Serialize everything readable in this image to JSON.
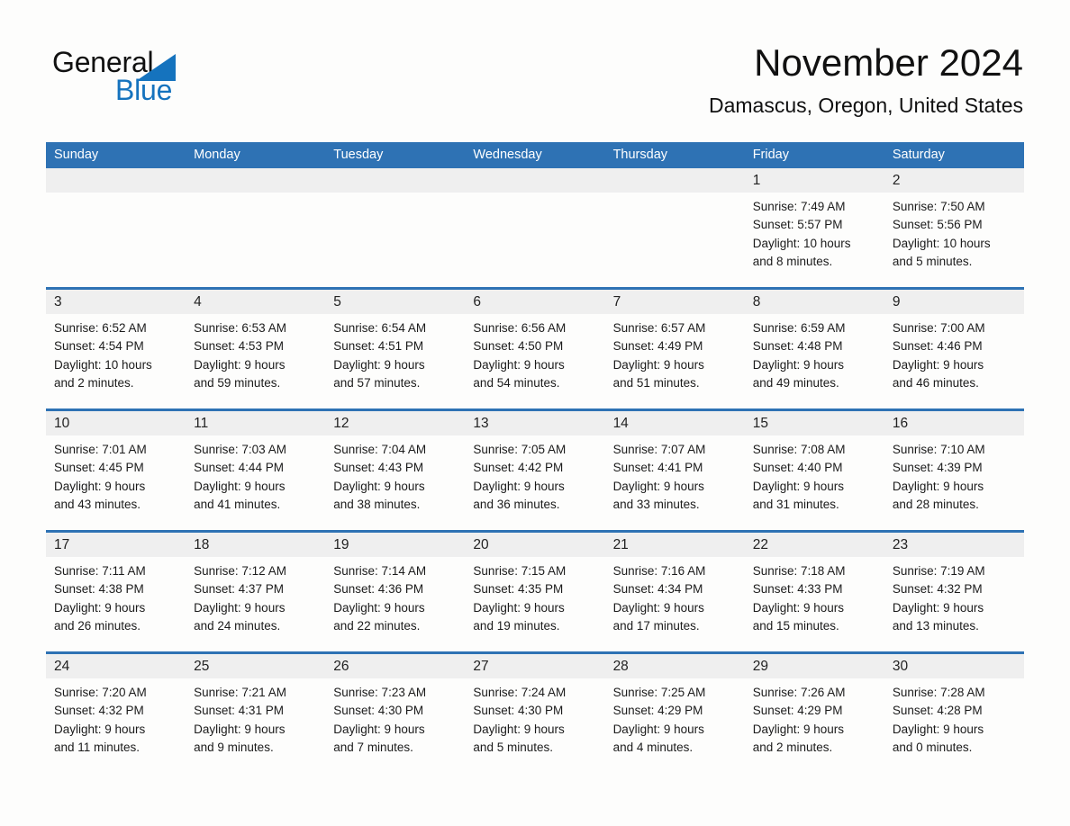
{
  "brand": {
    "name_part1": "General",
    "name_part2": "Blue",
    "triangle_color": "#1573BE"
  },
  "header": {
    "month_year": "November 2024",
    "location": "Damascus, Oregon, United States"
  },
  "theme": {
    "header_blue": "#2E72B4",
    "day_band_gray": "#EFEFEF",
    "page_background": "#FDFDFC",
    "text_color": "#1B1B1B"
  },
  "weekdays": [
    "Sunday",
    "Monday",
    "Tuesday",
    "Wednesday",
    "Thursday",
    "Friday",
    "Saturday"
  ],
  "weeks": [
    [
      {
        "day": "",
        "sunrise": "",
        "sunset": "",
        "daylight_line1": "",
        "daylight_line2": ""
      },
      {
        "day": "",
        "sunrise": "",
        "sunset": "",
        "daylight_line1": "",
        "daylight_line2": ""
      },
      {
        "day": "",
        "sunrise": "",
        "sunset": "",
        "daylight_line1": "",
        "daylight_line2": ""
      },
      {
        "day": "",
        "sunrise": "",
        "sunset": "",
        "daylight_line1": "",
        "daylight_line2": ""
      },
      {
        "day": "",
        "sunrise": "",
        "sunset": "",
        "daylight_line1": "",
        "daylight_line2": ""
      },
      {
        "day": "1",
        "sunrise": "Sunrise: 7:49 AM",
        "sunset": "Sunset: 5:57 PM",
        "daylight_line1": "Daylight: 10 hours",
        "daylight_line2": "and 8 minutes."
      },
      {
        "day": "2",
        "sunrise": "Sunrise: 7:50 AM",
        "sunset": "Sunset: 5:56 PM",
        "daylight_line1": "Daylight: 10 hours",
        "daylight_line2": "and 5 minutes."
      }
    ],
    [
      {
        "day": "3",
        "sunrise": "Sunrise: 6:52 AM",
        "sunset": "Sunset: 4:54 PM",
        "daylight_line1": "Daylight: 10 hours",
        "daylight_line2": "and 2 minutes."
      },
      {
        "day": "4",
        "sunrise": "Sunrise: 6:53 AM",
        "sunset": "Sunset: 4:53 PM",
        "daylight_line1": "Daylight: 9 hours",
        "daylight_line2": "and 59 minutes."
      },
      {
        "day": "5",
        "sunrise": "Sunrise: 6:54 AM",
        "sunset": "Sunset: 4:51 PM",
        "daylight_line1": "Daylight: 9 hours",
        "daylight_line2": "and 57 minutes."
      },
      {
        "day": "6",
        "sunrise": "Sunrise: 6:56 AM",
        "sunset": "Sunset: 4:50 PM",
        "daylight_line1": "Daylight: 9 hours",
        "daylight_line2": "and 54 minutes."
      },
      {
        "day": "7",
        "sunrise": "Sunrise: 6:57 AM",
        "sunset": "Sunset: 4:49 PM",
        "daylight_line1": "Daylight: 9 hours",
        "daylight_line2": "and 51 minutes."
      },
      {
        "day": "8",
        "sunrise": "Sunrise: 6:59 AM",
        "sunset": "Sunset: 4:48 PM",
        "daylight_line1": "Daylight: 9 hours",
        "daylight_line2": "and 49 minutes."
      },
      {
        "day": "9",
        "sunrise": "Sunrise: 7:00 AM",
        "sunset": "Sunset: 4:46 PM",
        "daylight_line1": "Daylight: 9 hours",
        "daylight_line2": "and 46 minutes."
      }
    ],
    [
      {
        "day": "10",
        "sunrise": "Sunrise: 7:01 AM",
        "sunset": "Sunset: 4:45 PM",
        "daylight_line1": "Daylight: 9 hours",
        "daylight_line2": "and 43 minutes."
      },
      {
        "day": "11",
        "sunrise": "Sunrise: 7:03 AM",
        "sunset": "Sunset: 4:44 PM",
        "daylight_line1": "Daylight: 9 hours",
        "daylight_line2": "and 41 minutes."
      },
      {
        "day": "12",
        "sunrise": "Sunrise: 7:04 AM",
        "sunset": "Sunset: 4:43 PM",
        "daylight_line1": "Daylight: 9 hours",
        "daylight_line2": "and 38 minutes."
      },
      {
        "day": "13",
        "sunrise": "Sunrise: 7:05 AM",
        "sunset": "Sunset: 4:42 PM",
        "daylight_line1": "Daylight: 9 hours",
        "daylight_line2": "and 36 minutes."
      },
      {
        "day": "14",
        "sunrise": "Sunrise: 7:07 AM",
        "sunset": "Sunset: 4:41 PM",
        "daylight_line1": "Daylight: 9 hours",
        "daylight_line2": "and 33 minutes."
      },
      {
        "day": "15",
        "sunrise": "Sunrise: 7:08 AM",
        "sunset": "Sunset: 4:40 PM",
        "daylight_line1": "Daylight: 9 hours",
        "daylight_line2": "and 31 minutes."
      },
      {
        "day": "16",
        "sunrise": "Sunrise: 7:10 AM",
        "sunset": "Sunset: 4:39 PM",
        "daylight_line1": "Daylight: 9 hours",
        "daylight_line2": "and 28 minutes."
      }
    ],
    [
      {
        "day": "17",
        "sunrise": "Sunrise: 7:11 AM",
        "sunset": "Sunset: 4:38 PM",
        "daylight_line1": "Daylight: 9 hours",
        "daylight_line2": "and 26 minutes."
      },
      {
        "day": "18",
        "sunrise": "Sunrise: 7:12 AM",
        "sunset": "Sunset: 4:37 PM",
        "daylight_line1": "Daylight: 9 hours",
        "daylight_line2": "and 24 minutes."
      },
      {
        "day": "19",
        "sunrise": "Sunrise: 7:14 AM",
        "sunset": "Sunset: 4:36 PM",
        "daylight_line1": "Daylight: 9 hours",
        "daylight_line2": "and 22 minutes."
      },
      {
        "day": "20",
        "sunrise": "Sunrise: 7:15 AM",
        "sunset": "Sunset: 4:35 PM",
        "daylight_line1": "Daylight: 9 hours",
        "daylight_line2": "and 19 minutes."
      },
      {
        "day": "21",
        "sunrise": "Sunrise: 7:16 AM",
        "sunset": "Sunset: 4:34 PM",
        "daylight_line1": "Daylight: 9 hours",
        "daylight_line2": "and 17 minutes."
      },
      {
        "day": "22",
        "sunrise": "Sunrise: 7:18 AM",
        "sunset": "Sunset: 4:33 PM",
        "daylight_line1": "Daylight: 9 hours",
        "daylight_line2": "and 15 minutes."
      },
      {
        "day": "23",
        "sunrise": "Sunrise: 7:19 AM",
        "sunset": "Sunset: 4:32 PM",
        "daylight_line1": "Daylight: 9 hours",
        "daylight_line2": "and 13 minutes."
      }
    ],
    [
      {
        "day": "24",
        "sunrise": "Sunrise: 7:20 AM",
        "sunset": "Sunset: 4:32 PM",
        "daylight_line1": "Daylight: 9 hours",
        "daylight_line2": "and 11 minutes."
      },
      {
        "day": "25",
        "sunrise": "Sunrise: 7:21 AM",
        "sunset": "Sunset: 4:31 PM",
        "daylight_line1": "Daylight: 9 hours",
        "daylight_line2": "and 9 minutes."
      },
      {
        "day": "26",
        "sunrise": "Sunrise: 7:23 AM",
        "sunset": "Sunset: 4:30 PM",
        "daylight_line1": "Daylight: 9 hours",
        "daylight_line2": "and 7 minutes."
      },
      {
        "day": "27",
        "sunrise": "Sunrise: 7:24 AM",
        "sunset": "Sunset: 4:30 PM",
        "daylight_line1": "Daylight: 9 hours",
        "daylight_line2": "and 5 minutes."
      },
      {
        "day": "28",
        "sunrise": "Sunrise: 7:25 AM",
        "sunset": "Sunset: 4:29 PM",
        "daylight_line1": "Daylight: 9 hours",
        "daylight_line2": "and 4 minutes."
      },
      {
        "day": "29",
        "sunrise": "Sunrise: 7:26 AM",
        "sunset": "Sunset: 4:29 PM",
        "daylight_line1": "Daylight: 9 hours",
        "daylight_line2": "and 2 minutes."
      },
      {
        "day": "30",
        "sunrise": "Sunrise: 7:28 AM",
        "sunset": "Sunset: 4:28 PM",
        "daylight_line1": "Daylight: 9 hours",
        "daylight_line2": "and 0 minutes."
      }
    ]
  ]
}
